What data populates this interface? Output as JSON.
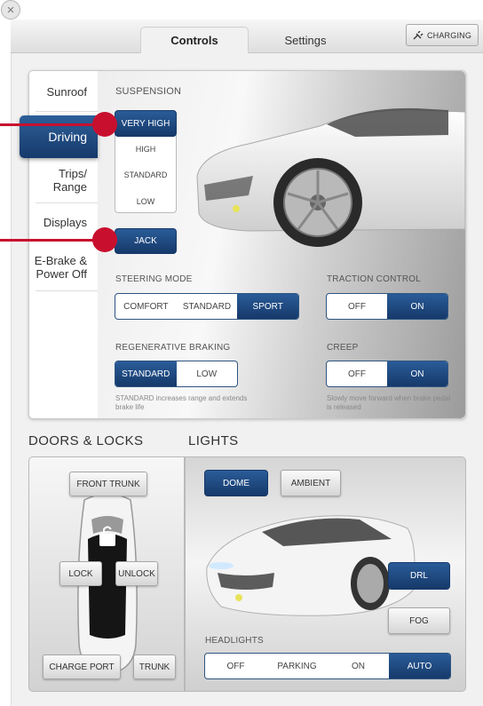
{
  "window": {
    "close_glyph": "×"
  },
  "tabs": [
    {
      "label": "Controls",
      "active": true
    },
    {
      "label": "Settings",
      "active": false
    }
  ],
  "charging": {
    "label": "CHARGING",
    "icon": "plug-icon"
  },
  "sidebar": {
    "items": [
      {
        "label": "Sunroof"
      },
      {
        "label": "Driving",
        "active": true
      },
      {
        "label": "Trips/ Range"
      },
      {
        "label": "Displays"
      },
      {
        "label": "E-Brake & Power Off"
      }
    ]
  },
  "suspension": {
    "title": "SUSPENSION",
    "options": [
      "VERY HIGH",
      "HIGH",
      "STANDARD",
      "LOW"
    ],
    "selected": "VERY HIGH",
    "jack_label": "JACK"
  },
  "steering": {
    "title": "STEERING MODE",
    "options": [
      "COMFORT",
      "STANDARD",
      "SPORT"
    ],
    "selected": "SPORT"
  },
  "traction": {
    "title": "TRACTION CONTROL",
    "options": [
      "OFF",
      "ON"
    ],
    "selected": "ON"
  },
  "regen": {
    "title": "REGENERATIVE BRAKING",
    "options": [
      "STANDARD",
      "LOW"
    ],
    "selected": "STANDARD",
    "note": "STANDARD increases range and extends brake life"
  },
  "creep": {
    "title": "CREEP",
    "options": [
      "OFF",
      "ON"
    ],
    "selected": "ON",
    "note": "Slowly move forward when brake pedal is released"
  },
  "doors": {
    "title": "DOORS & LOCKS",
    "front_trunk": "FRONT TRUNK",
    "lock": "LOCK",
    "unlock": "UNLOCK",
    "charge_port": "CHARGE PORT",
    "trunk": "TRUNK"
  },
  "lights": {
    "title": "LIGHTS",
    "dome": "DOME",
    "ambient": "AMBIENT",
    "drl": "DRL",
    "fog": "FOG",
    "headlights_title": "HEADLIGHTS",
    "headlights_options": [
      "OFF",
      "PARKING",
      "ON",
      "AUTO"
    ],
    "headlights_selected": "AUTO"
  },
  "colors": {
    "accent_blue": "#1f4a80",
    "pointer_red": "#c8102e"
  }
}
